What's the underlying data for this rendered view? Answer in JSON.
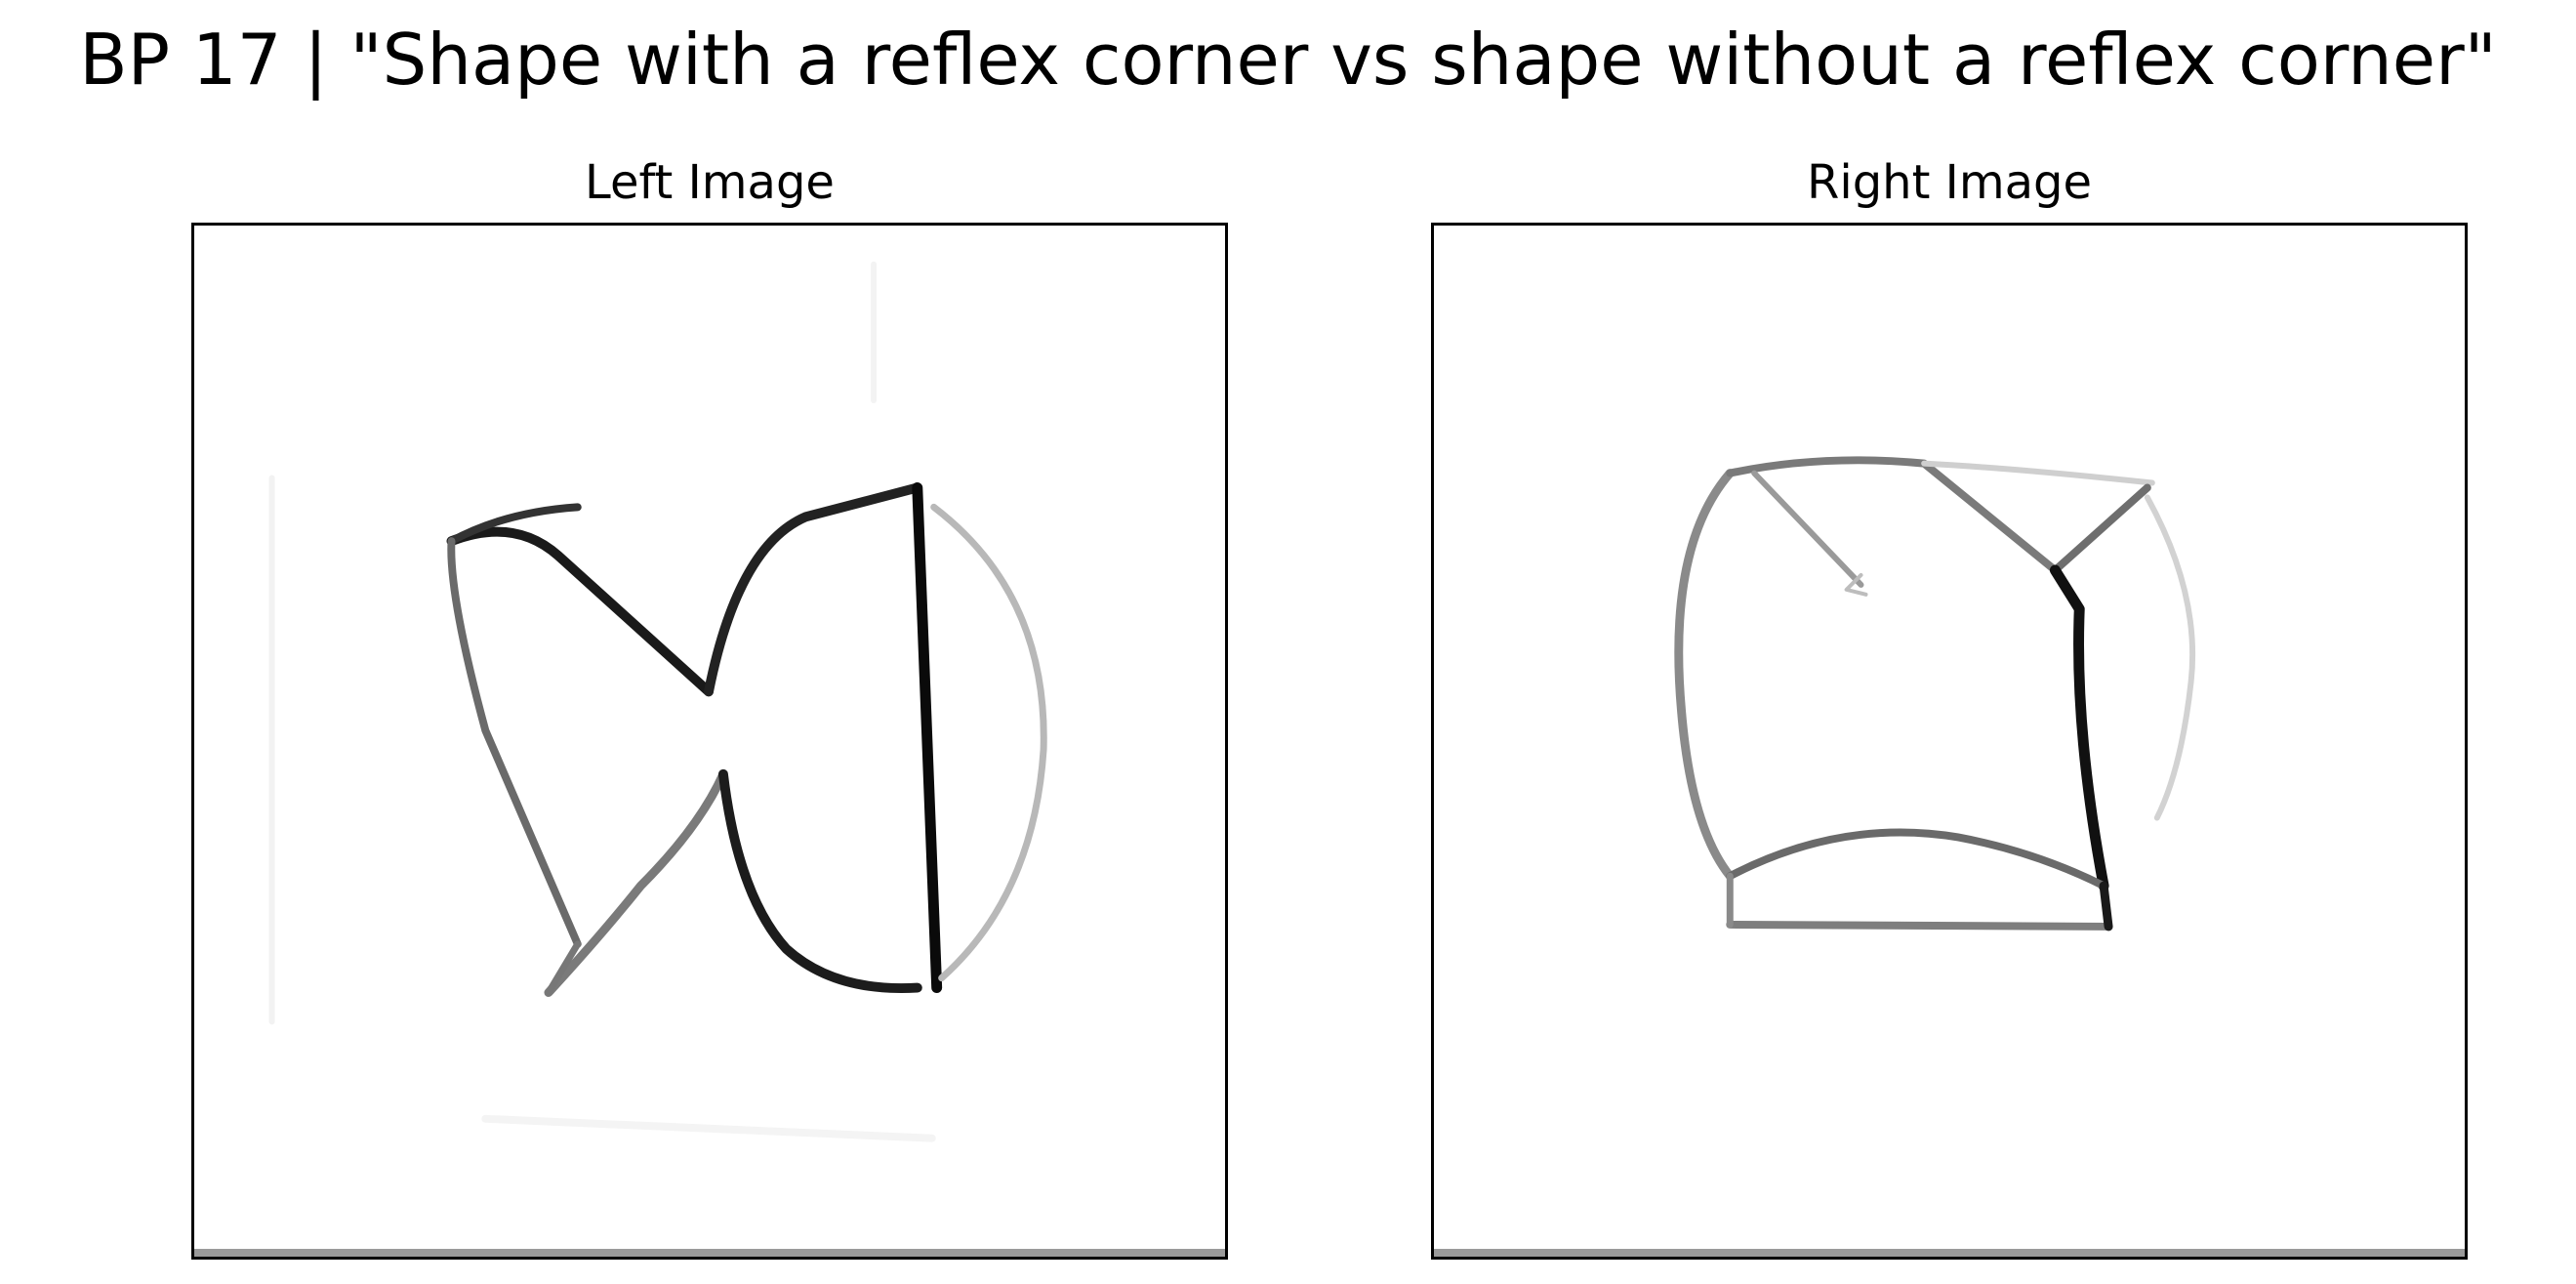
{
  "figure": {
    "title": "BP 17 | \"Shape with a reflex corner vs shape without a reflex corner\""
  },
  "panels": [
    {
      "title": "Left Image",
      "shape": "reflex-corner-shape"
    },
    {
      "title": "Right Image",
      "shape": "convex-shape"
    }
  ]
}
